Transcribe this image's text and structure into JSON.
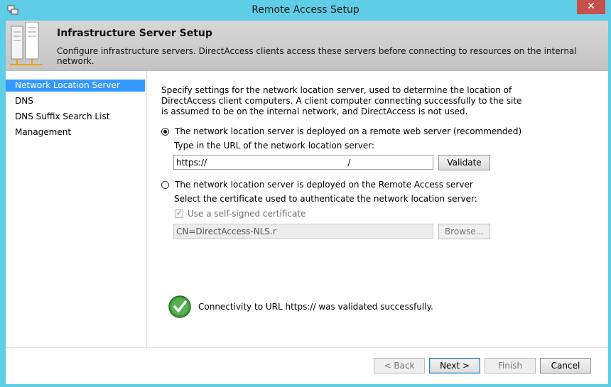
{
  "window": {
    "title": "Remote Access Setup",
    "close_glyph": "✕",
    "icon": "remote-access-icon"
  },
  "header": {
    "title": "Infrastructure Server Setup",
    "description": "Configure infrastructure servers. DirectAccess clients access these servers before connecting to resources on the internal network.",
    "icon": "servers-icon"
  },
  "nav": {
    "items": [
      {
        "label": "Network Location Server",
        "selected": true
      },
      {
        "label": "DNS",
        "selected": false
      },
      {
        "label": "DNS Suffix Search List",
        "selected": false
      },
      {
        "label": "Management",
        "selected": false
      }
    ]
  },
  "content": {
    "intro": "Specify settings for the network location server, used to determine the location of DirectAccess client computers. A client computer connecting successfully to the site is assumed to be on the internal network, and DirectAccess is not used.",
    "option_remote": {
      "label": "The network location server is deployed on a remote web server (recommended)",
      "checked": true,
      "url_label": "Type in the URL of the network location server:",
      "url_value": "https://                                                    /",
      "validate_label": "Validate"
    },
    "option_local": {
      "label": "The network location server is deployed on the Remote Access server",
      "checked": false,
      "cert_label": "Select the certificate used to authenticate the network location server:",
      "self_signed_label": "Use a self-signed certificate",
      "self_signed_checked": true,
      "cert_value": "CN=DirectAccess-NLS.r",
      "browse_label": "Browse..."
    },
    "status": {
      "icon": "check-circle-icon",
      "text": "Connectivity to URL https://                                                    was validated successfully."
    }
  },
  "footer": {
    "back_label": "< Back",
    "next_label": "Next >",
    "finish_label": "Finish",
    "cancel_label": "Cancel"
  }
}
